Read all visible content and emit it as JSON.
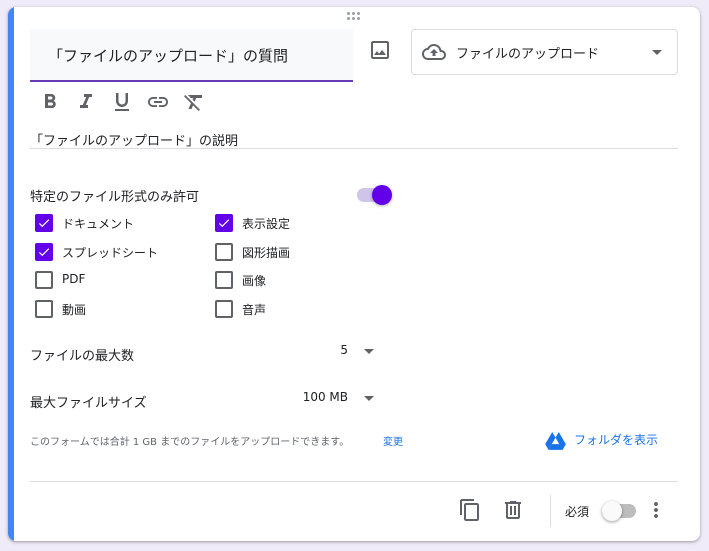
{
  "question": {
    "title": "「ファイルのアップロード」の質問",
    "description": "「ファイルのアップロード」の説明",
    "type_label": "ファイルのアップロード"
  },
  "icons": {
    "drag": "drag-handle-icon",
    "image": "image-icon",
    "type": "cloud-upload-icon",
    "bold": "bold-icon",
    "italic": "italic-icon",
    "underline": "underline-icon",
    "link": "link-icon",
    "clear": "clear-formatting-icon",
    "drive": "google-drive-icon",
    "duplicate": "duplicate-icon",
    "delete": "trash-icon",
    "more": "more-vert-icon"
  },
  "restrict": {
    "label": "特定のファイル形式のみ許可",
    "enabled": true
  },
  "file_types": [
    {
      "label": "ドキュメント",
      "checked": true
    },
    {
      "label": "スプレッドシート",
      "checked": true
    },
    {
      "label": "PDF",
      "checked": false
    },
    {
      "label": "動画",
      "checked": false
    },
    {
      "label": "表示設定",
      "checked": true
    },
    {
      "label": "図形描画",
      "checked": false
    },
    {
      "label": "画像",
      "checked": false
    },
    {
      "label": "音声",
      "checked": false
    }
  ],
  "max_files": {
    "label": "ファイルの最大数",
    "value": "5"
  },
  "max_size": {
    "label": "最大ファイルサイズ",
    "value": "100 MB"
  },
  "quota": {
    "text": "このフォームでは合計 1 GB までのファイルをアップロードできます。",
    "change_label": "変更"
  },
  "folder": {
    "label": "フォルダを表示"
  },
  "footer": {
    "required_label": "必須",
    "required": false
  },
  "colors": {
    "accent": "#673ab7",
    "checkbox": "#6200ea",
    "left_bar": "#4285f4",
    "link": "#1a73e8",
    "background": "#f0ebf8"
  }
}
